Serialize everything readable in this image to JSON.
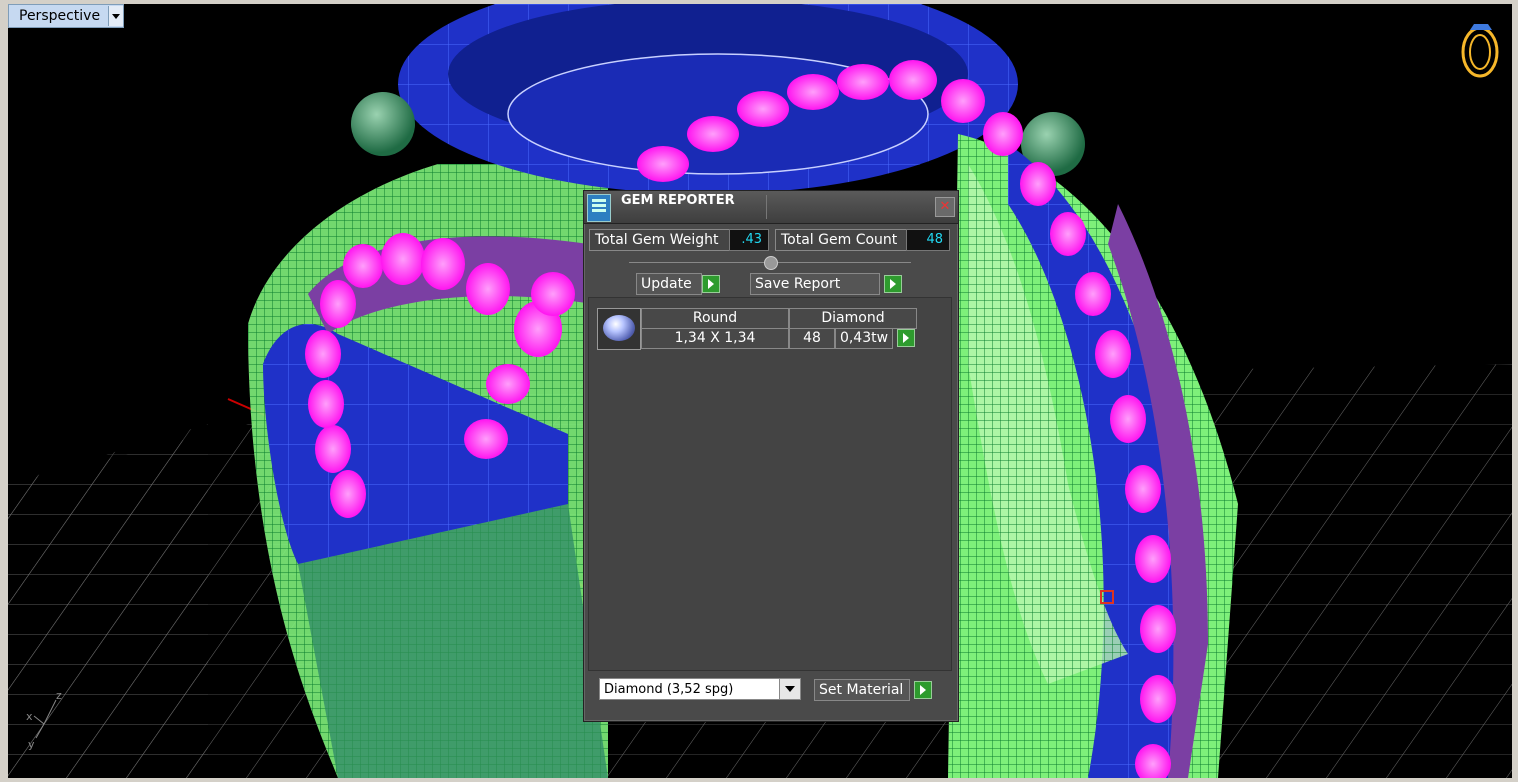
{
  "viewport": {
    "name": "Perspective",
    "axis_labels": [
      "z",
      "x",
      "y"
    ]
  },
  "gem_reporter": {
    "title": "GEM REPORTER",
    "close_glyph": "✕",
    "total_weight_label": "Total Gem Weight",
    "total_weight_value": ".43",
    "total_count_label": "Total Gem Count",
    "total_count_value": "48",
    "update_label": "Update",
    "save_report_label": "Save Report",
    "rows": [
      {
        "shape": "Round",
        "size": "1,34 X 1,34",
        "material": "Diamond",
        "count": "48",
        "weight": "0,43tw"
      }
    ],
    "material_select": "Diamond    (3,52 spg)",
    "set_material_label": "Set Material"
  },
  "colors": {
    "metal_blue": "#1f31c8",
    "prong_green": "#3f9c6a",
    "wire_green": "#7ef07a",
    "gem_magenta": "#ff2df5",
    "gem_purple": "#7b3fa3",
    "value_cyan": "#21d7f0"
  }
}
